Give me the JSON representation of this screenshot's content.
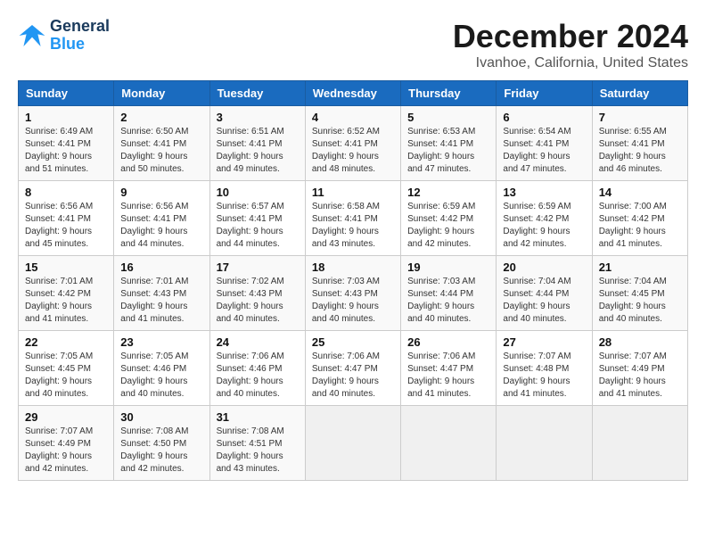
{
  "header": {
    "logo_line1": "General",
    "logo_line2": "Blue",
    "title": "December 2024",
    "subtitle": "Ivanhoe, California, United States"
  },
  "calendar": {
    "days_of_week": [
      "Sunday",
      "Monday",
      "Tuesday",
      "Wednesday",
      "Thursday",
      "Friday",
      "Saturday"
    ],
    "weeks": [
      [
        {
          "day": "1",
          "info": "Sunrise: 6:49 AM\nSunset: 4:41 PM\nDaylight: 9 hours\nand 51 minutes."
        },
        {
          "day": "2",
          "info": "Sunrise: 6:50 AM\nSunset: 4:41 PM\nDaylight: 9 hours\nand 50 minutes."
        },
        {
          "day": "3",
          "info": "Sunrise: 6:51 AM\nSunset: 4:41 PM\nDaylight: 9 hours\nand 49 minutes."
        },
        {
          "day": "4",
          "info": "Sunrise: 6:52 AM\nSunset: 4:41 PM\nDaylight: 9 hours\nand 48 minutes."
        },
        {
          "day": "5",
          "info": "Sunrise: 6:53 AM\nSunset: 4:41 PM\nDaylight: 9 hours\nand 47 minutes."
        },
        {
          "day": "6",
          "info": "Sunrise: 6:54 AM\nSunset: 4:41 PM\nDaylight: 9 hours\nand 47 minutes."
        },
        {
          "day": "7",
          "info": "Sunrise: 6:55 AM\nSunset: 4:41 PM\nDaylight: 9 hours\nand 46 minutes."
        }
      ],
      [
        {
          "day": "8",
          "info": "Sunrise: 6:56 AM\nSunset: 4:41 PM\nDaylight: 9 hours\nand 45 minutes."
        },
        {
          "day": "9",
          "info": "Sunrise: 6:56 AM\nSunset: 4:41 PM\nDaylight: 9 hours\nand 44 minutes."
        },
        {
          "day": "10",
          "info": "Sunrise: 6:57 AM\nSunset: 4:41 PM\nDaylight: 9 hours\nand 44 minutes."
        },
        {
          "day": "11",
          "info": "Sunrise: 6:58 AM\nSunset: 4:41 PM\nDaylight: 9 hours\nand 43 minutes."
        },
        {
          "day": "12",
          "info": "Sunrise: 6:59 AM\nSunset: 4:42 PM\nDaylight: 9 hours\nand 42 minutes."
        },
        {
          "day": "13",
          "info": "Sunrise: 6:59 AM\nSunset: 4:42 PM\nDaylight: 9 hours\nand 42 minutes."
        },
        {
          "day": "14",
          "info": "Sunrise: 7:00 AM\nSunset: 4:42 PM\nDaylight: 9 hours\nand 41 minutes."
        }
      ],
      [
        {
          "day": "15",
          "info": "Sunrise: 7:01 AM\nSunset: 4:42 PM\nDaylight: 9 hours\nand 41 minutes."
        },
        {
          "day": "16",
          "info": "Sunrise: 7:01 AM\nSunset: 4:43 PM\nDaylight: 9 hours\nand 41 minutes."
        },
        {
          "day": "17",
          "info": "Sunrise: 7:02 AM\nSunset: 4:43 PM\nDaylight: 9 hours\nand 40 minutes."
        },
        {
          "day": "18",
          "info": "Sunrise: 7:03 AM\nSunset: 4:43 PM\nDaylight: 9 hours\nand 40 minutes."
        },
        {
          "day": "19",
          "info": "Sunrise: 7:03 AM\nSunset: 4:44 PM\nDaylight: 9 hours\nand 40 minutes."
        },
        {
          "day": "20",
          "info": "Sunrise: 7:04 AM\nSunset: 4:44 PM\nDaylight: 9 hours\nand 40 minutes."
        },
        {
          "day": "21",
          "info": "Sunrise: 7:04 AM\nSunset: 4:45 PM\nDaylight: 9 hours\nand 40 minutes."
        }
      ],
      [
        {
          "day": "22",
          "info": "Sunrise: 7:05 AM\nSunset: 4:45 PM\nDaylight: 9 hours\nand 40 minutes."
        },
        {
          "day": "23",
          "info": "Sunrise: 7:05 AM\nSunset: 4:46 PM\nDaylight: 9 hours\nand 40 minutes."
        },
        {
          "day": "24",
          "info": "Sunrise: 7:06 AM\nSunset: 4:46 PM\nDaylight: 9 hours\nand 40 minutes."
        },
        {
          "day": "25",
          "info": "Sunrise: 7:06 AM\nSunset: 4:47 PM\nDaylight: 9 hours\nand 40 minutes."
        },
        {
          "day": "26",
          "info": "Sunrise: 7:06 AM\nSunset: 4:47 PM\nDaylight: 9 hours\nand 41 minutes."
        },
        {
          "day": "27",
          "info": "Sunrise: 7:07 AM\nSunset: 4:48 PM\nDaylight: 9 hours\nand 41 minutes."
        },
        {
          "day": "28",
          "info": "Sunrise: 7:07 AM\nSunset: 4:49 PM\nDaylight: 9 hours\nand 41 minutes."
        }
      ],
      [
        {
          "day": "29",
          "info": "Sunrise: 7:07 AM\nSunset: 4:49 PM\nDaylight: 9 hours\nand 42 minutes."
        },
        {
          "day": "30",
          "info": "Sunrise: 7:08 AM\nSunset: 4:50 PM\nDaylight: 9 hours\nand 42 minutes."
        },
        {
          "day": "31",
          "info": "Sunrise: 7:08 AM\nSunset: 4:51 PM\nDaylight: 9 hours\nand 43 minutes."
        },
        {
          "day": "",
          "info": ""
        },
        {
          "day": "",
          "info": ""
        },
        {
          "day": "",
          "info": ""
        },
        {
          "day": "",
          "info": ""
        }
      ]
    ]
  }
}
